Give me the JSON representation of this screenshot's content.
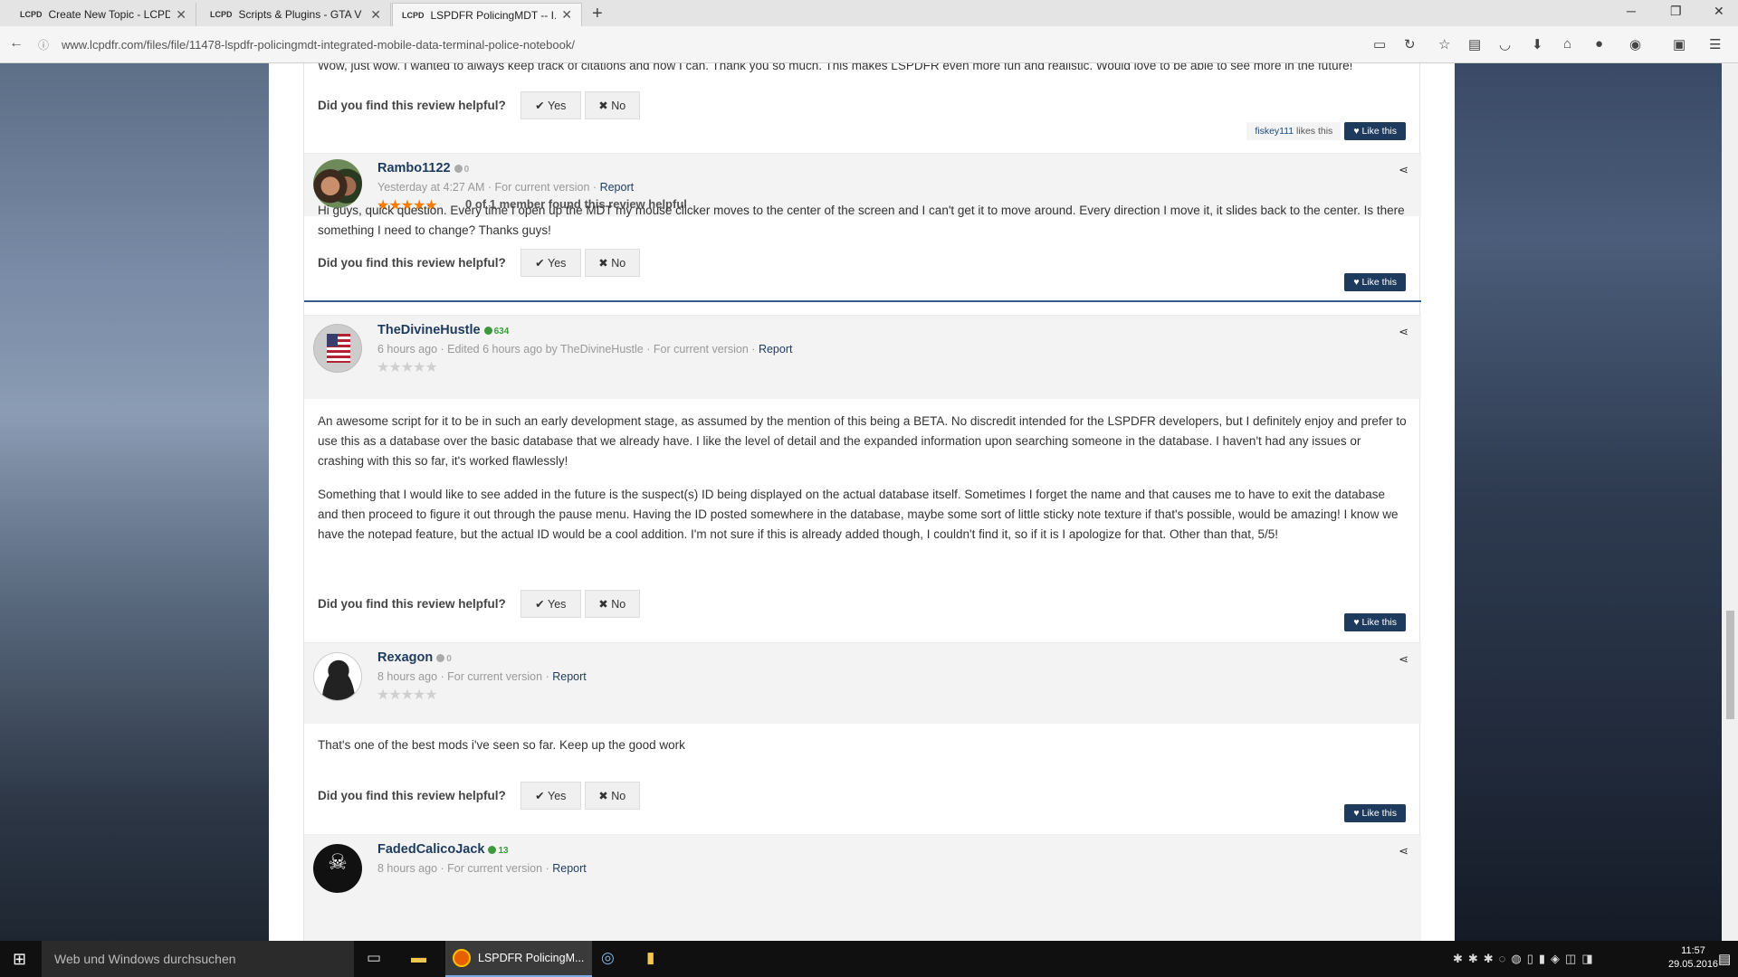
{
  "browser": {
    "tabs": [
      {
        "label": "Create New Topic - LCPD...",
        "active": false
      },
      {
        "label": "Scripts & Plugins - GTA V ...",
        "active": false
      },
      {
        "label": "LSPDFR PolicingMDT -- I...",
        "active": true
      }
    ],
    "favicon_text": "LCPD",
    "url": "www.lcpdfr.com/files/file/11478-lspdfr-policingmdt-integrated-mobile-data-terminal-police-notebook/",
    "toolbar_icons": [
      "reader-icon",
      "reload-icon",
      "star-icon",
      "clipboard-icon",
      "pocket-icon",
      "download-icon",
      "home-icon",
      "chat-icon",
      "extension-icon",
      "extension2-icon",
      "menu-icon"
    ]
  },
  "common": {
    "helpful_question": "Did you find this review helpful?",
    "yes": "Yes",
    "no": "No",
    "like": "Like this",
    "report": "Report",
    "for_current_version": "For current version",
    "sep": "·"
  },
  "top_review": {
    "text": "Wow, just wow. I wanted to always keep track of citations and now I can. Thank you so much. This makes LSPDFR even more fun and realistic. Would love to be able to see more in the future!",
    "liker": "fiskey111",
    "likes_suffix": "likes this"
  },
  "reviews": [
    {
      "username": "Rambo1122",
      "reputation": "0",
      "time": "Yesterday at 4:27 AM",
      "edited": "",
      "stars": "★★★★★",
      "helpful_count": "0 of 1 member found this review helpful",
      "paragraphs": [
        "Hi guys, quick question. Every time I open up the MDT my mouse clicker moves to the center of the screen and I can't get it to move around. Every direction I move it, it slides back to the cen­ter. Is there something I need to change? Thanks guys!"
      ]
    },
    {
      "username": "TheDivineHustle",
      "reputation": "634",
      "time": "6 hours ago",
      "edited": "Edited 6 hours ago by TheDivineHustle",
      "stars": "★★★★★",
      "helpful_count": "",
      "paragraphs": [
        "An awesome script for it to be in such an early development stage, as assumed by the mention of this being a BETA. No discredit intended for the LSPDFR developers, but I definitely enjoy and prefer to use this as a database over the basic database that we already have. I like the level of detail and the expanded information upon searching someone in the database. I haven't had any issues or crashing with this so far, it's worked flawlessly!",
        "Something that I would like to see added in the future is the suspect(s) ID being displayed on the actual database itself. Sometimes I forget the name and that causes me to have to exit the database and then proceed to figure it out through the pause menu. Having the ID posted somewhere in the database, maybe some sort of little sticky note texture if that's possible, would be amazing! I know we have the notepad feature, but the actual ID would be a cool addition. I'm not sure if this is already added though, I couldn't find it, so if it is I apologize for that. Other than that, 5/5!"
      ]
    },
    {
      "username": "Rexagon",
      "reputation": "0",
      "time": "8 hours ago",
      "edited": "",
      "stars": "★★★★★",
      "helpful_count": "",
      "paragraphs": [
        "That's one of the best mods i've seen so far. Keep up the good work"
      ]
    },
    {
      "username": "FadedCalicoJack",
      "reputation": "13",
      "time": "8 hours ago",
      "edited": "",
      "stars": "",
      "helpful_count": "",
      "paragraphs": []
    }
  ],
  "taskbar": {
    "search_placeholder": "Web und Windows durchsuchen",
    "firefox_label": "LSPDFR PolicingM...",
    "time": "11:57",
    "date": "29.05.2016"
  },
  "colors": {
    "username": "#1e3b5e",
    "star_filled": "#ff7a00",
    "star_empty": "#cfcfcf",
    "rep_positive": "#3c9a3c",
    "rep_neutral": "#aaaaaa",
    "separator": "#335c8c",
    "like_button": "#1e3b5e"
  }
}
